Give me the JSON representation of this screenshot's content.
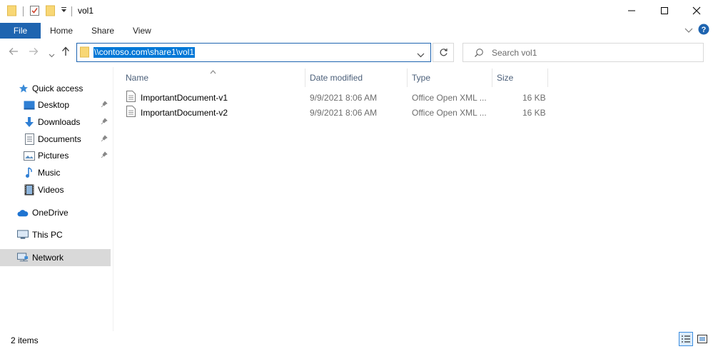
{
  "window": {
    "title": "vol1"
  },
  "ribbon": {
    "tabs": [
      "File",
      "Home",
      "Share",
      "View"
    ]
  },
  "address": {
    "path": "\\\\contoso.com\\share1\\vol1"
  },
  "search": {
    "placeholder": "Search vol1"
  },
  "nav": {
    "quick_access": "Quick access",
    "desktop": "Desktop",
    "downloads": "Downloads",
    "documents": "Documents",
    "pictures": "Pictures",
    "music": "Music",
    "videos": "Videos",
    "onedrive": "OneDrive",
    "this_pc": "This PC",
    "network": "Network"
  },
  "columns": {
    "name": "Name",
    "date": "Date modified",
    "type": "Type",
    "size": "Size"
  },
  "files": [
    {
      "name": "ImportantDocument-v1",
      "date": "9/9/2021 8:06 AM",
      "type": "Office Open XML ...",
      "size": "16 KB"
    },
    {
      "name": "ImportantDocument-v2",
      "date": "9/9/2021 8:06 AM",
      "type": "Office Open XML ...",
      "size": "16 KB"
    }
  ],
  "status": {
    "item_count": "2 items"
  },
  "colors": {
    "accent": "#1e64b0",
    "selection": "#0078d7",
    "help": "#1e64b0"
  }
}
